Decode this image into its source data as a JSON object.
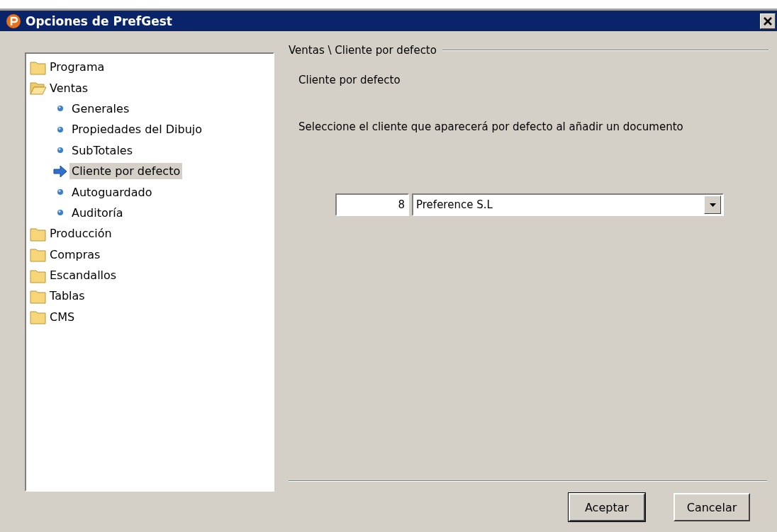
{
  "window": {
    "title": "Opciones de PrefGest"
  },
  "tree": [
    {
      "label": "Programa",
      "expanded": false,
      "selected": false
    },
    {
      "label": "Ventas",
      "expanded": true,
      "selected": false,
      "children": [
        {
          "label": "Generales",
          "selected": false
        },
        {
          "label": "Propiedades del Dibujo",
          "selected": false
        },
        {
          "label": "SubTotales",
          "selected": false
        },
        {
          "label": "Cliente por defecto",
          "selected": true
        },
        {
          "label": "Autoguardado",
          "selected": false
        },
        {
          "label": "Auditoría",
          "selected": false
        }
      ]
    },
    {
      "label": "Producción",
      "expanded": false,
      "selected": false
    },
    {
      "label": "Compras",
      "expanded": false,
      "selected": false
    },
    {
      "label": "Escandallos",
      "expanded": false,
      "selected": false
    },
    {
      "label": "Tablas",
      "expanded": false,
      "selected": false
    },
    {
      "label": "CMS",
      "expanded": false,
      "selected": false
    }
  ],
  "panel": {
    "breadcrumb": "Ventas \\ Cliente por defecto",
    "heading": "Cliente por defecto",
    "description": "Seleccione el cliente que aparecerá por defecto al añadir un documento",
    "client_code": "8",
    "client_name": "Preference S.L"
  },
  "buttons": [
    "Aceptar",
    "Cancelar"
  ]
}
